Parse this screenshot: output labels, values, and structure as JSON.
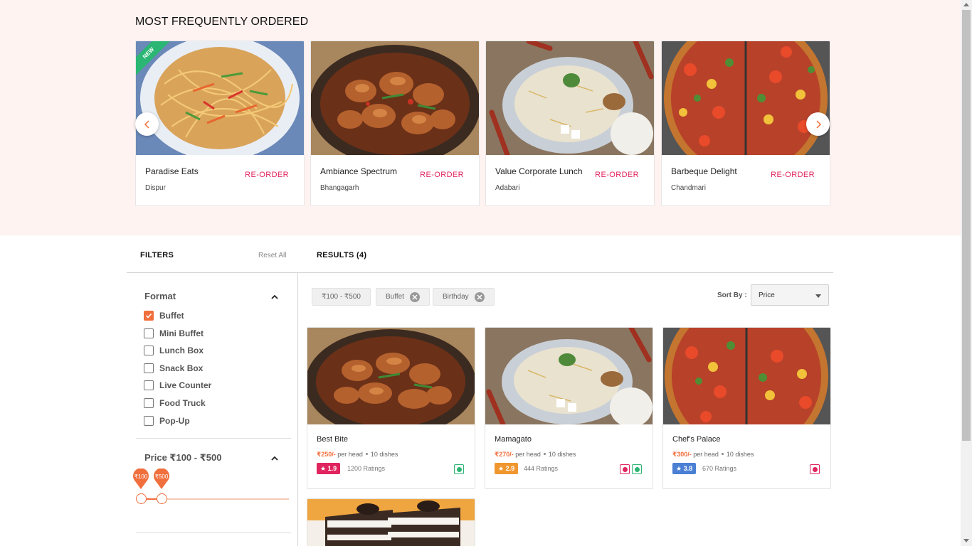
{
  "most_frequently_ordered": {
    "title": "MOST FREQUENTLY ORDERED",
    "items": [
      {
        "name": "Paradise Eats",
        "location": "Dispur",
        "action": "RE-ORDER",
        "badge": "NEW",
        "image": "noodles-image"
      },
      {
        "name": "Ambiance Spectrum",
        "location": "Bhangagarh",
        "action": "RE-ORDER",
        "image": "chicken-curry-image"
      },
      {
        "name": "Value Corporate Lunch",
        "location": "Adabari",
        "action": "RE-ORDER",
        "image": "biryani-image"
      },
      {
        "name": "Barbeque Delight",
        "location": "Chandmari",
        "action": "RE-ORDER",
        "image": "pizza-image"
      }
    ],
    "prev_icon": "chevron-left-icon",
    "next_icon": "chevron-right-icon"
  },
  "filters": {
    "title": "FILTERS",
    "reset_label": "Reset All",
    "format": {
      "title": "Format",
      "options": [
        {
          "label": "Buffet",
          "checked": true
        },
        {
          "label": "Mini Buffet",
          "checked": false
        },
        {
          "label": "Lunch Box",
          "checked": false
        },
        {
          "label": "Snack Box",
          "checked": false
        },
        {
          "label": "Live Counter",
          "checked": false
        },
        {
          "label": "Food Truck",
          "checked": false
        },
        {
          "label": "Pop-Up",
          "checked": false
        }
      ]
    },
    "price": {
      "title": "Price ₹100 - ₹500",
      "min_label": "₹100",
      "max_label": "₹500",
      "range_fraction": [
        0.0,
        0.14
      ]
    }
  },
  "results": {
    "title": "RESULTS (4)",
    "applied_filters": [
      "₹100 - ₹500",
      "Buffet",
      "Birthday"
    ],
    "sort_label": "Sort By :",
    "sort_value": "Price",
    "items": [
      {
        "name": "Best Bite",
        "price": "₹250/-",
        "per": "per head",
        "dishes": "10 dishes",
        "rating": "1.9",
        "rating_color": "#e0245e",
        "ratings_count": "1200 Ratings",
        "veg": true,
        "nonveg": false,
        "image": "chicken-curry-image"
      },
      {
        "name": "Mamagato",
        "price": "₹270/-",
        "per": "per head",
        "dishes": "10 dishes",
        "rating": "2.9",
        "rating_color": "#f0962e",
        "ratings_count": "444 Ratings",
        "veg": true,
        "nonveg": true,
        "image": "biryani-image"
      },
      {
        "name": "Chef's Palace",
        "price": "₹300/-",
        "per": "per head",
        "dishes": "10 dishes",
        "rating": "3.8",
        "rating_color": "#4a7fd4",
        "ratings_count": "670 Ratings",
        "veg": false,
        "nonveg": true,
        "image": "pizza-image"
      },
      {
        "image": "cake-image"
      }
    ]
  },
  "colors": {
    "accent": "#f06f3d",
    "reorder": "#e0245e",
    "band_bg": "#fff3f1",
    "veg": "#2bb673",
    "nonveg": "#e0245e"
  }
}
